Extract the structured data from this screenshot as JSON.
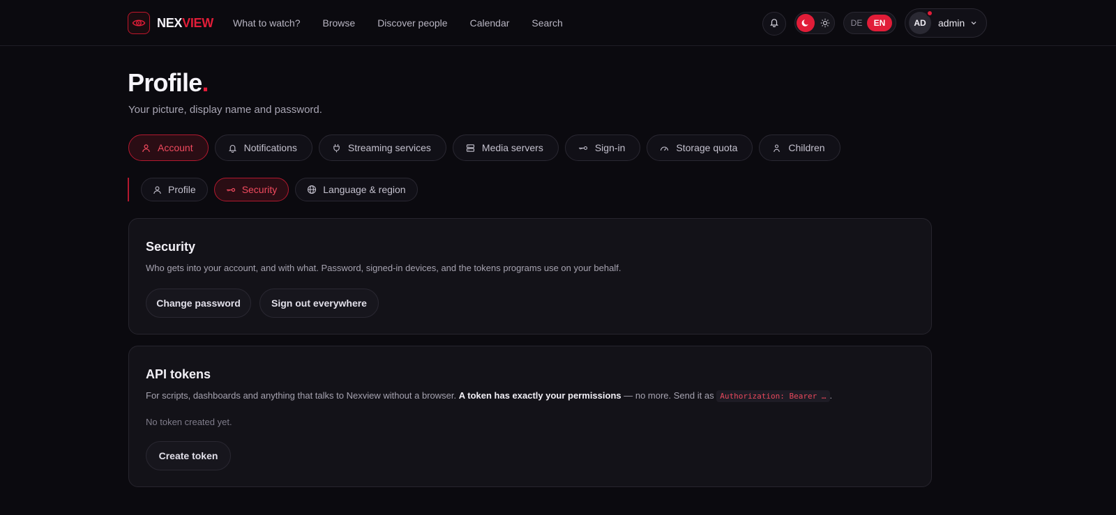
{
  "brand": {
    "part1": "NEX",
    "part2": "VIEW"
  },
  "nav": [
    {
      "label": "What to watch?"
    },
    {
      "label": "Browse"
    },
    {
      "label": "Discover people"
    },
    {
      "label": "Calendar"
    },
    {
      "label": "Search"
    }
  ],
  "header": {
    "lang_de": "DE",
    "lang_en": "EN",
    "avatar_initials": "AD",
    "user_name": "admin"
  },
  "page": {
    "title": "Profile",
    "title_dot": ".",
    "subtitle": "Your picture, display name and password."
  },
  "tabs": [
    {
      "label": "Account",
      "icon": "user-icon",
      "active": true
    },
    {
      "label": "Notifications",
      "icon": "bell-icon",
      "active": false
    },
    {
      "label": "Streaming services",
      "icon": "plug-icon",
      "active": false
    },
    {
      "label": "Media servers",
      "icon": "server-icon",
      "active": false
    },
    {
      "label": "Sign-in",
      "icon": "key-icon",
      "active": false
    },
    {
      "label": "Storage quota",
      "icon": "gauge-icon",
      "active": false
    },
    {
      "label": "Children",
      "icon": "child-icon",
      "active": false
    }
  ],
  "subtabs": [
    {
      "label": "Profile",
      "icon": "user-icon",
      "active": false
    },
    {
      "label": "Security",
      "icon": "key-icon",
      "active": true
    },
    {
      "label": "Language & region",
      "icon": "globe-icon",
      "active": false
    }
  ],
  "security": {
    "title": "Security",
    "description": "Who gets into your account, and with what. Password, signed-in devices, and the tokens programs use on your behalf.",
    "change_password": "Change password",
    "sign_out_everywhere": "Sign out everywhere"
  },
  "tokens": {
    "title": "API tokens",
    "desc_part1": "For scripts, dashboards and anything that talks to Nexview without a browser. ",
    "desc_bold": "A token has exactly your permissions",
    "desc_part2": " — no more. Send it as ",
    "desc_code": "Authorization: Bearer …",
    "desc_end": ".",
    "empty": "No token created yet.",
    "create": "Create token"
  },
  "colors": {
    "accent": "#e11d38",
    "background": "#0b0a0f",
    "card": "#131218"
  }
}
